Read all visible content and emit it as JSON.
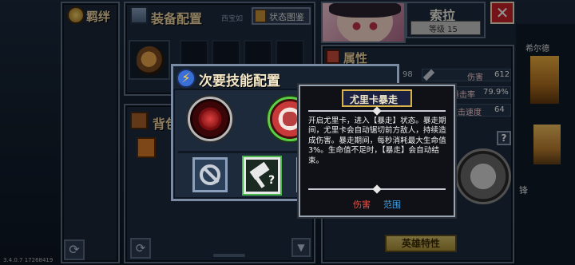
{
  "bg": {
    "bonds_label": "羁绊",
    "equip_title": "装备配置",
    "equip_sub": "西宝如",
    "status_btn": "状态图鉴",
    "backpack_label": "背包",
    "attr_title": "属性",
    "hero_trait_btn": "英雄特性",
    "right_name_small": "希尔德",
    "right_label_small": "锋",
    "version": "3.4.0.7 17268419",
    "hero": {
      "name": "索拉",
      "level": "等级 15"
    },
    "stats": [
      {
        "label": "伤害",
        "value": "612"
      },
      {
        "label": "暴击率",
        "value": "79.9%"
      },
      {
        "label": "攻击速度",
        "value": "64"
      }
    ],
    "stat_value_left": "98"
  },
  "dialog": {
    "title": "次要技能配置",
    "slots": [
      {
        "name": "skill-red-rune"
      },
      {
        "name": "skill-white-beast"
      }
    ],
    "actions": [
      {
        "name": "no-skill"
      },
      {
        "name": "mystery-skill",
        "mark": "?"
      }
    ]
  },
  "tooltip": {
    "title": "尤里卡暴走",
    "body": "开启尤里卡，进入【暴走】状态。暴走期间，尤里卡会自动锯切前方敌人，持续造成伤害。暴走期间，每秒消耗最大生命值3%。生命值不足时，【暴走】会自动结束。",
    "tag_damage": "伤害",
    "tag_range": "范围"
  },
  "colors": {
    "accent_yellow": "#f5c84a",
    "damage_red": "#e8534a",
    "range_blue": "#4aa3e8"
  }
}
